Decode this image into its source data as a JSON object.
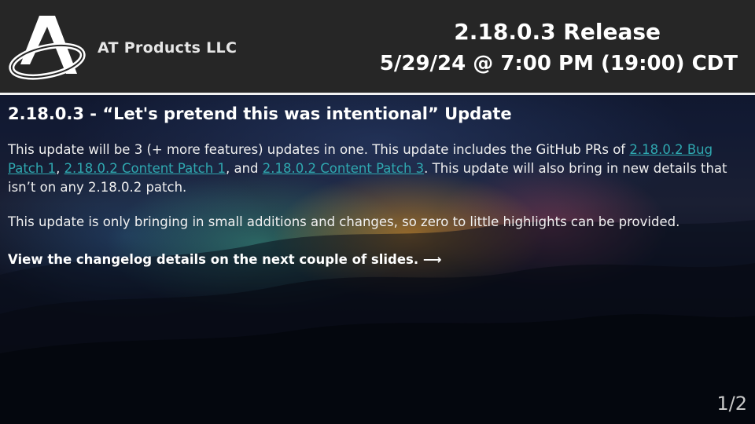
{
  "header": {
    "company_name": "AT Products LLC",
    "release_title": "2.18.0.3 Release",
    "release_date": "5/29/24 @ 7:00 PM (19:00) CDT"
  },
  "main": {
    "update_title": "2.18.0.3 - “Let's pretend this was intentional” Update",
    "paragraph1": {
      "text_before": "This update will be 3 (+ more features) updates in one. This update includes the GitHub PRs of ",
      "link1": "2.18.0.2 Bug Patch 1",
      "sep1": ", ",
      "link2": "2.18.0.2 Content Patch 1",
      "sep2": ", and ",
      "link3": "2.18.0.2 Content Patch 3",
      "text_after": ". This update will also bring in new details that isn’t on any 2.18.0.2 patch."
    },
    "paragraph2": "This update is only bringing in small additions and changes, so zero to little highlights can be provided.",
    "cta": "View the changelog details on the next couple of slides. ⟶"
  },
  "page_number": "1/2",
  "colors": {
    "header_bg": "#262626",
    "header_border": "#f2f2f2",
    "link": "#2fa8b0",
    "text": "#ffffff"
  },
  "icons": {
    "logo": "at-products-logo-icon"
  }
}
